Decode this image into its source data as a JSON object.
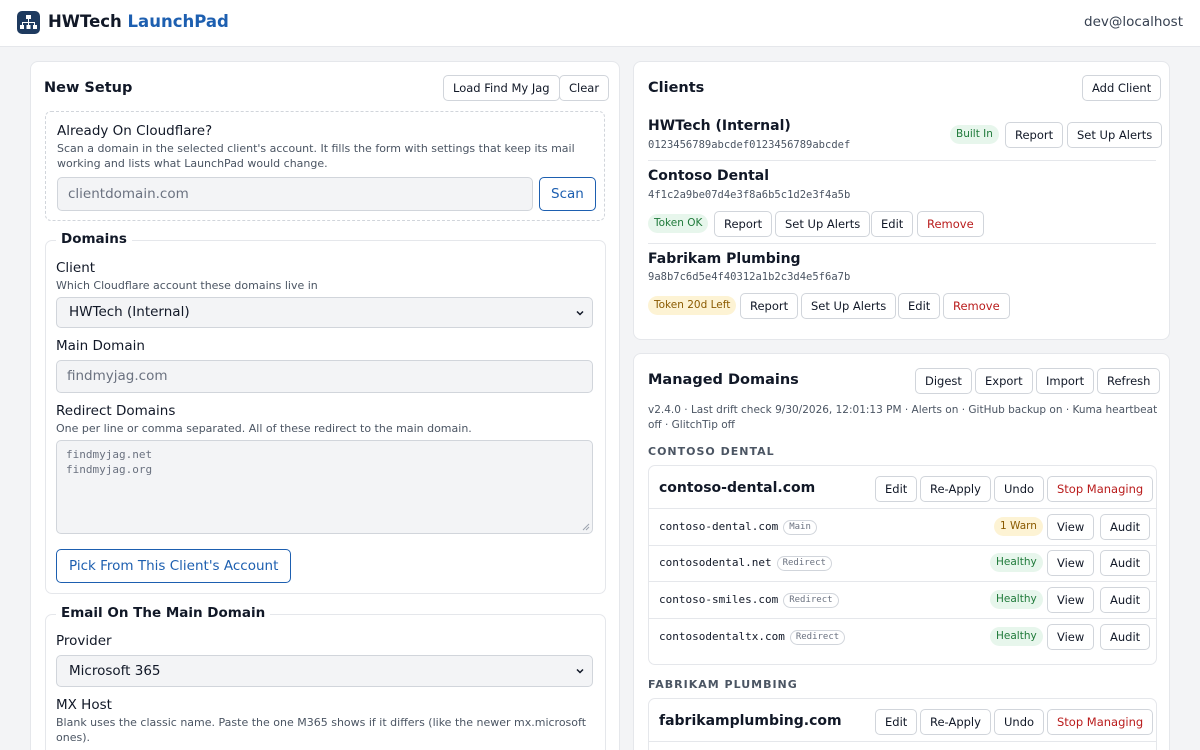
{
  "app": {
    "name": "HWTech",
    "name_accent": "LaunchPad",
    "user": "dev@localhost"
  },
  "new_setup": {
    "title": "New Setup",
    "load_button": "Load Find My Jag",
    "clear_button": "Clear",
    "cloudflare": {
      "heading": "Already On Cloudflare?",
      "help": "Scan a domain in the selected client's account. It fills the form with settings that keep its mail working and lists what LaunchPad would change.",
      "placeholder": "clientdomain.com",
      "scan_button": "Scan"
    },
    "domains": {
      "legend": "Domains",
      "client_label": "Client",
      "client_help": "Which Cloudflare account these domains live in",
      "client_value": "HWTech (Internal)",
      "main_label": "Main Domain",
      "main_placeholder": "findmyjag.com",
      "redirect_label": "Redirect Domains",
      "redirect_help": "One per line or comma separated. All of these redirect to the main domain.",
      "redirect_line1": "findmyjag.net",
      "redirect_line2": "findmyjag.org",
      "pick_button": "Pick From This Client's Account"
    },
    "email": {
      "legend": "Email On The Main Domain",
      "provider_label": "Provider",
      "provider_value": "Microsoft 365",
      "mx_label": "MX Host",
      "mx_help": "Blank uses the classic name. Paste the one M365 shows if it differs (like the newer mx.microsoft ones)."
    }
  },
  "clients": {
    "title": "Clients",
    "add_button": "Add Client",
    "items": [
      {
        "name": "HWTech (Internal)",
        "id": "0123456789abcdef0123456789abcdef",
        "badge": "Built In",
        "report": "Report",
        "alerts": "Set Up Alerts"
      },
      {
        "name": "Contoso Dental",
        "id": "4f1c2a9be07d4e3f8a6b5c1d2e3f4a5b",
        "badge": "Token OK",
        "report": "Report",
        "alerts": "Set Up Alerts",
        "edit": "Edit",
        "remove": "Remove"
      },
      {
        "name": "Fabrikam Plumbing",
        "id": "9a8b7c6d5e4f40312a1b2c3d4e5f6a7b",
        "badge": "Token 20d Left",
        "report": "Report",
        "alerts": "Set Up Alerts",
        "edit": "Edit",
        "remove": "Remove"
      }
    ]
  },
  "managed": {
    "title": "Managed Domains",
    "buttons": {
      "digest": "Digest",
      "export": "Export",
      "import": "Import",
      "refresh": "Refresh"
    },
    "status_line": "v2.4.0 · Last drift check 9/30/2026, 12:01:13 PM · Alerts on · GitHub backup on · Kuma heartbeat off · GlitchTip off",
    "groups": [
      {
        "title": "CONTOSO DENTAL",
        "domain": "contoso-dental.com",
        "edit": "Edit",
        "reapply": "Re-Apply",
        "undo": "Undo",
        "stop": "Stop Managing",
        "rows": [
          {
            "domain": "contoso-dental.com",
            "tag": "Main",
            "status": "1 Warn",
            "view": "View",
            "audit": "Audit"
          },
          {
            "domain": "contosodental.net",
            "tag": "Redirect",
            "status": "Healthy",
            "view": "View",
            "audit": "Audit"
          },
          {
            "domain": "contoso-smiles.com",
            "tag": "Redirect",
            "status": "Healthy",
            "view": "View",
            "audit": "Audit"
          },
          {
            "domain": "contosodentaltx.com",
            "tag": "Redirect",
            "status": "Healthy",
            "view": "View",
            "audit": "Audit"
          }
        ]
      },
      {
        "title": "FABRIKAM PLUMBING",
        "domain": "fabrikamplumbing.com",
        "edit": "Edit",
        "reapply": "Re-Apply",
        "undo": "Undo",
        "stop": "Stop Managing"
      }
    ]
  },
  "colors": {
    "brand": "#1d5fb0",
    "danger": "#b91c1c",
    "healthy_bg": "#e7f6ec",
    "warn_bg": "#fdf3d4"
  }
}
